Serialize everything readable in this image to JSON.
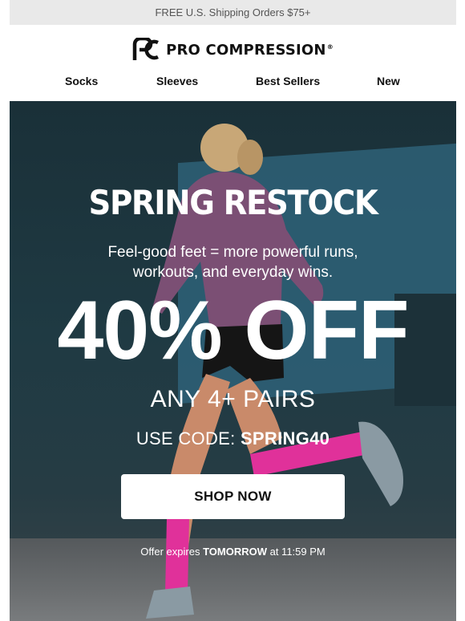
{
  "promo_bar": {
    "text": "FREE U.S. Shipping Orders $75+"
  },
  "brand": {
    "name": "PRO COMPRESSION",
    "reg_mark": "®",
    "logo_icon": "pc-monogram-icon"
  },
  "nav": {
    "items": [
      {
        "label": "Socks"
      },
      {
        "label": "Sleeves"
      },
      {
        "label": "Best Sellers"
      },
      {
        "label": "New"
      }
    ]
  },
  "hero": {
    "title": "SPRING RESTOCK",
    "subtitle_line1": "Feel-good feet = more powerful runs,",
    "subtitle_line2": "workouts, and everyday wins.",
    "offer": "40% OFF",
    "pairs": "ANY 4+ PAIRS",
    "code_prefix": "USE CODE: ",
    "code": "SPRING40",
    "cta": "SHOP NOW",
    "expires_prefix": "Offer expires ",
    "expires_day": "TOMORROW",
    "expires_suffix": " at 11:59 PM"
  },
  "colors": {
    "accent_sock": "#e0319a",
    "hero_bg": "#1f3a43",
    "wall_blue": "#2e6178",
    "promo_bg": "#e9e9e9"
  }
}
